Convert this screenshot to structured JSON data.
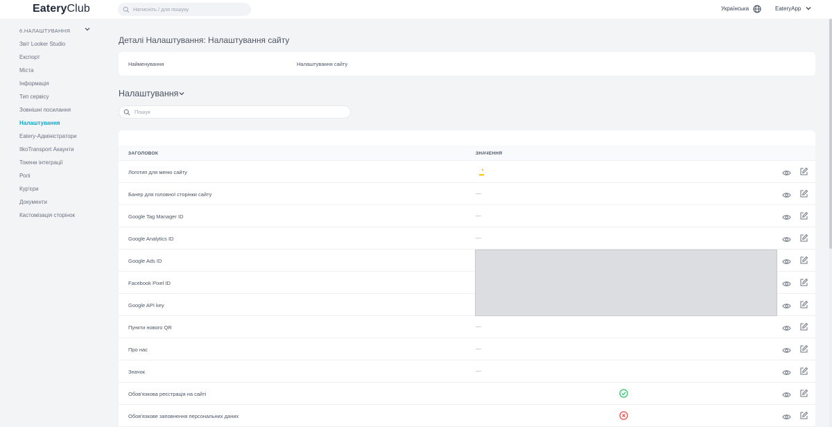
{
  "topbar": {
    "logo_bold": "Eatery",
    "logo_light": "Club",
    "search_placeholder": "Натисніть / для пошуку",
    "language": "Українська",
    "app_name": "EateryApp"
  },
  "sidebar": {
    "section_title": "6.НАЛАШТУВАННЯ",
    "items": [
      {
        "label": "Звіт Looker Studio",
        "active": false
      },
      {
        "label": "Експорт",
        "active": false
      },
      {
        "label": "Міста",
        "active": false
      },
      {
        "label": "Інформація",
        "active": false
      },
      {
        "label": "Тип сервісу",
        "active": false
      },
      {
        "label": "Зовнішні посилання",
        "active": false
      },
      {
        "label": "Налаштування",
        "active": true
      },
      {
        "label": "Eatery-Адміністратори",
        "active": false
      },
      {
        "label": "IlkoTransport Акаунти",
        "active": false
      },
      {
        "label": "Токени інтеграції",
        "active": false
      },
      {
        "label": "Ролі",
        "active": false
      },
      {
        "label": "Кур'єри",
        "active": false
      },
      {
        "label": "Документи",
        "active": false
      },
      {
        "label": "Кастомізація сторінок",
        "active": false
      }
    ]
  },
  "main": {
    "page_title": "Деталі Налаштування: Налаштування сайту",
    "details": {
      "key": "Найменування",
      "value": "Налаштування сайту"
    },
    "section_title": "Налаштування",
    "search_placeholder": "Пошук",
    "table": {
      "columns": [
        "ЗАГОЛОВОК",
        "ЗНАЧЕННЯ"
      ],
      "rows": [
        {
          "title": "Логотип для меню сайту",
          "value": "",
          "kind": "logo"
        },
        {
          "title": "Банер для головної сторінки сайту",
          "value": "—",
          "kind": "dash"
        },
        {
          "title": "Google Tag Manager ID",
          "value": "—",
          "kind": "dash"
        },
        {
          "title": "Google Analytics ID",
          "value": "—",
          "kind": "dash"
        },
        {
          "title": "Google Ads ID",
          "value": "",
          "kind": "redacted"
        },
        {
          "title": "Facebook Pixel ID",
          "value": "",
          "kind": "redacted"
        },
        {
          "title": "Google API key",
          "value": "",
          "kind": "redacted"
        },
        {
          "title": "Пункти нового QR",
          "value": "—",
          "kind": "dash"
        },
        {
          "title": "Про нас",
          "value": "—",
          "kind": "dash"
        },
        {
          "title": "Значок",
          "value": "—",
          "kind": "dash"
        },
        {
          "title": "Обов'язкова реєстрація на сайті",
          "value": "",
          "kind": "check-true"
        },
        {
          "title": "Обов'язкове заповнення персональних даних",
          "value": "",
          "kind": "check-false"
        }
      ]
    }
  },
  "colors": {
    "accent": "#0ea5c6",
    "success": "#22c55e",
    "danger": "#ef4444",
    "icon": "#6b7280"
  }
}
